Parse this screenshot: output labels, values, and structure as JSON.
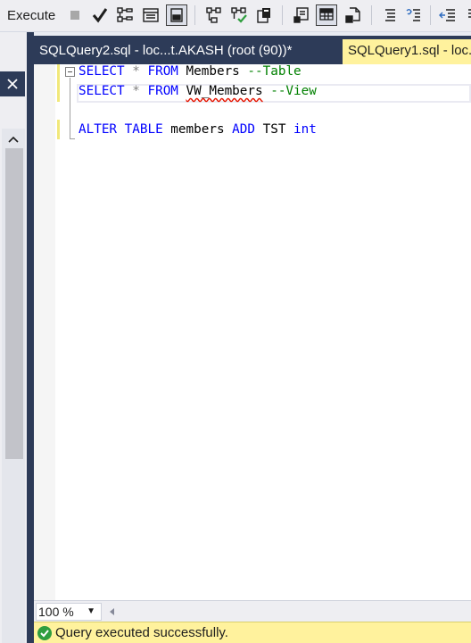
{
  "toolbar": {
    "execute_label": "Execute",
    "icons": [
      "stop-icon",
      "parse-check-icon",
      "display-estimated-plan-icon",
      "query-options-icon",
      "intellisense-icon",
      "include-actual-plan-icon",
      "live-query-statistics-icon",
      "client-statistics-icon",
      "results-to-text-icon",
      "results-to-grid-icon",
      "results-to-file-icon",
      "comment-lines-icon",
      "uncomment-lines-icon",
      "decrease-indent-icon"
    ]
  },
  "tabs": [
    {
      "label": "SQLQuery2.sql - loc...t.AKASH (root (90))*",
      "active": false
    },
    {
      "label": "SQLQuery1.sql - loc...",
      "active": true
    }
  ],
  "editor": {
    "lines": [
      {
        "keyword1": "SELECT",
        "op": "*",
        "keyword2": "FROM",
        "ident": "Members",
        "comment": "--Table"
      },
      {
        "keyword1": "SELECT",
        "op": "*",
        "keyword2": "FROM",
        "ident": "VW_Members",
        "comment": "--View"
      },
      {
        "alter": "ALTER TABLE",
        "table": "members",
        "add": "ADD",
        "col": "TST",
        "type": "int"
      }
    ]
  },
  "zoom": {
    "value": "100 %"
  },
  "status": {
    "text": "Query executed successfully."
  },
  "colors": {
    "accent": "#2d3b58",
    "active_tab": "#fff29d",
    "keyword": "#0000ff",
    "comment": "#008000",
    "success": "#2f9e3f"
  }
}
